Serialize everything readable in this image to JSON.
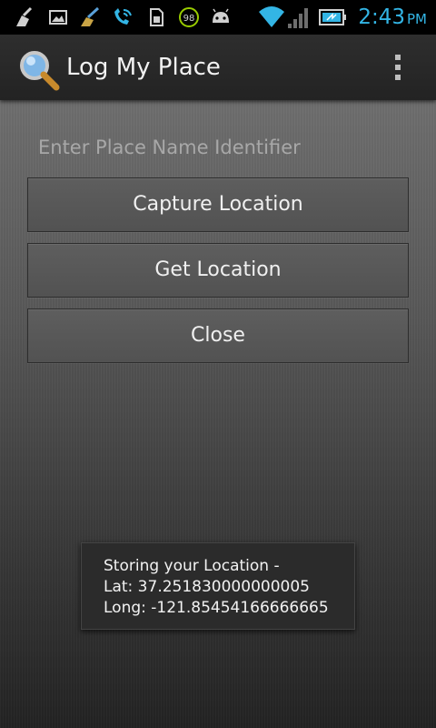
{
  "status_bar": {
    "time": "2:43",
    "ampm": "PM",
    "battery_badge": "98",
    "icons": [
      "broom-icon",
      "image-icon",
      "cleaner-icon",
      "wifi-call-icon",
      "sim-icon",
      "battery-percent-icon",
      "android-icon",
      "wifi-icon",
      "signal-icon",
      "battery-icon"
    ]
  },
  "action_bar": {
    "title": "Log My Place",
    "app_icon": "magnifier-icon",
    "overflow_icon": "overflow-menu-icon"
  },
  "form": {
    "place_placeholder": "Enter Place Name Identifier",
    "place_value": ""
  },
  "buttons": {
    "capture": "Capture Location",
    "get": "Get Location",
    "close": "Close"
  },
  "toast": {
    "line1": "Storing your Location -",
    "line2": "Lat: 37.251830000000005",
    "line3": "Long: -121.85454166666665"
  },
  "colors": {
    "clock": "#33b5e5",
    "status_icons": "#d0d0d0",
    "battery_text": "#99cc00"
  }
}
